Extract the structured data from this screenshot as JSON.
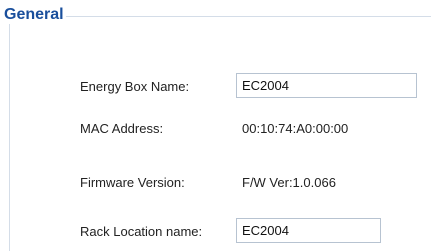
{
  "section": {
    "title": "General"
  },
  "fields": {
    "energy_box_name": {
      "label": "Energy Box Name:",
      "value": "EC2004"
    },
    "mac_address": {
      "label": "MAC Address:",
      "value": "00:10:74:A0:00:00"
    },
    "firmware_version": {
      "label": "Firmware Version:",
      "value": "F/W Ver:1.0.066"
    },
    "rack_location_name": {
      "label": "Rack Location name:",
      "value": "EC2004"
    }
  },
  "colors": {
    "legend": "#1a4f9c",
    "border": "#d4dde8",
    "input_border": "#b7c3d1"
  }
}
